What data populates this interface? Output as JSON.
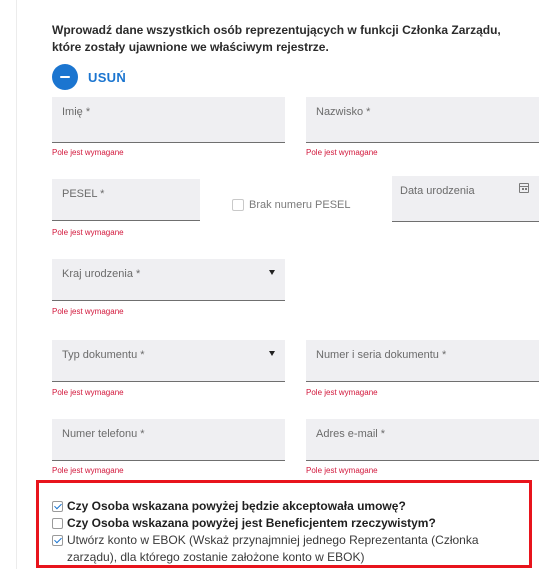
{
  "intro_text": "Wprowadź dane wszystkich osób reprezentujących w funkcji Członka Zarządu, które zostały ujawnione we właściwym rejestrze.",
  "remove_button": {
    "label": "USUŃ",
    "icon": "minus-icon"
  },
  "fields": {
    "first_name": {
      "label": "Imię *",
      "error": "Pole jest wymagane"
    },
    "last_name": {
      "label": "Nazwisko *",
      "error": "Pole jest wymagane"
    },
    "pesel": {
      "label": "PESEL *",
      "error": "Pole jest wymagane"
    },
    "no_pesel": {
      "label": "Brak numeru PESEL",
      "checked": false
    },
    "birth_date": {
      "label": "Data urodzenia",
      "icon": "calendar-icon"
    },
    "birth_country": {
      "label": "Kraj urodzenia *",
      "error": "Pole jest wymagane"
    },
    "document_type": {
      "label": "Typ dokumentu *",
      "error": "Pole jest wymagane"
    },
    "document_number": {
      "label": "Numer i seria dokumentu *",
      "error": "Pole jest wymagane"
    },
    "phone": {
      "label": "Numer telefonu *",
      "error": "Pole jest wymagane"
    },
    "email": {
      "label": "Adres e-mail *",
      "error": "Pole jest wymagane"
    }
  },
  "checkboxes": [
    {
      "label": "Czy Osoba wskazana powyżej będzie akceptowała umowę?",
      "checked": true,
      "bold": true
    },
    {
      "label": "Czy Osoba wskazana powyżej jest Beneficjentem rzeczywistym?",
      "checked": false,
      "bold": true
    },
    {
      "label": "Utwórz konto w EBOK (Wskaż przynajmniej jednego Reprezentanta (Członka zarządu), dla którego zostanie założone konto w EBOK)",
      "checked": true,
      "bold": false
    }
  ],
  "colors": {
    "accent": "#1b75d0",
    "error": "#d2173b",
    "highlight_border": "#e8141c",
    "field_bg": "#efeff2"
  }
}
